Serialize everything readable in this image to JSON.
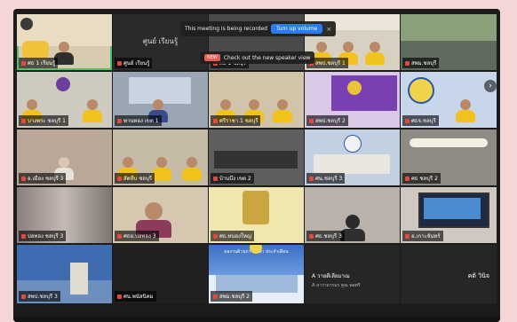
{
  "notifications": {
    "recording": {
      "text": "This meeting is being recorded",
      "button_label": "Turn up volume",
      "close_glyph": "×"
    },
    "new_feature": {
      "tag": "NEW",
      "text": "Check out the new speaker view"
    }
  },
  "tiles": [
    {
      "label": "ศธ 1 เรียนรู้"
    },
    {
      "label": "ศูนย์ เรียนรู้",
      "big": "ศูนย์ เรียนรู้"
    },
    {
      "label": "ศธ 1 ชลบุรี"
    },
    {
      "label": "สพป.ชลบุรี 1"
    },
    {
      "label": "สพม.ชลบุรี"
    },
    {
      "label": "บางพระ ชลบุรี 1"
    },
    {
      "label": "พานทอง เขต 1"
    },
    {
      "label": "ศรีราชา 1 ชลบุรี"
    },
    {
      "label": "สพป.ชลบุรี 2"
    },
    {
      "label": "ศธจ.ชลบุรี"
    },
    {
      "label": "อ.เมือง ชลบุรี 3"
    },
    {
      "label": "สัตหีบ ชลบุรี"
    },
    {
      "label": "บ้านบึง เขต 2"
    },
    {
      "label": "ศน.ชลบุรี 3"
    },
    {
      "label": "ศธ ชลบุรี 2"
    },
    {
      "label": "บ่อทอง ชลบุรี 3"
    },
    {
      "label": "ศธอ.บ่อทอง 3"
    },
    {
      "label": "ศธ.หนองใหญ่"
    },
    {
      "label": "ศธ.ชลบุรี 3"
    },
    {
      "label": "อ.เกาะจันทร์"
    },
    {
      "label": "สพป.ชลบุรี 3"
    },
    {
      "label": "ศน.พนัสนิคม"
    },
    {
      "label": "สพม.ชลบุรี 2",
      "banner": "ผลงานด้านการศึกษา ประจำเดือน"
    },
    {
      "label": "A วายดีเลียมาเม",
      "big": "A วายดีเลียมาเม",
      "sub": "A ลาวาดารมร คูณ พลศรี"
    },
    {
      "label": "คติ วินิจ",
      "big": "คติ วินิจ"
    }
  ],
  "colors": {
    "page_bg": "#f4d6d6",
    "frame_bg": "#1c1c1c",
    "active_outline": "#49c26b",
    "button_blue": "#2d7bf0",
    "mic_red": "#e04a3f",
    "shirt_yellow": "#f2c31c"
  },
  "icons": {
    "mic_muted": "mic-muted-icon",
    "gallery_next": "chevron-right-icon",
    "close": "close-icon"
  }
}
